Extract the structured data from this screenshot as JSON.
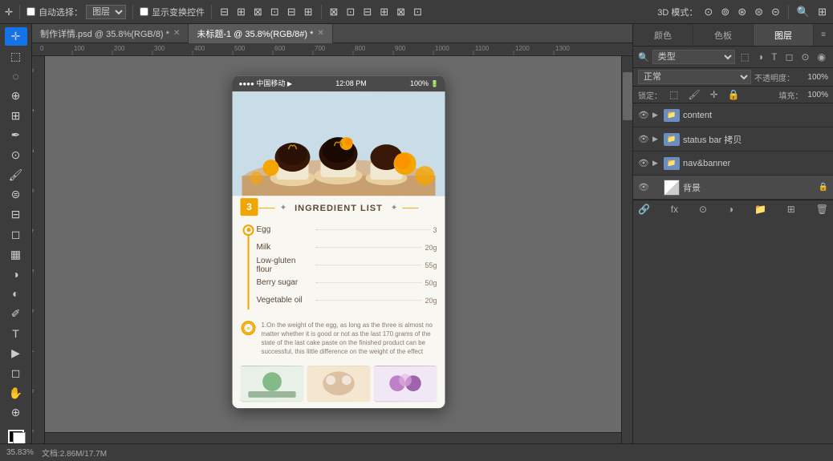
{
  "app": {
    "title": "Adobe Photoshop"
  },
  "toolbar": {
    "auto_select_label": "自动选择：",
    "layer_label": "图层",
    "show_transform_label": "显示变换控件",
    "mode_3d": "3D 模式："
  },
  "tabs": [
    {
      "label": "制作详情.psd @ 35.8%(RGB/8)",
      "active": false,
      "modified": true
    },
    {
      "label": "未标题-1 @ 35.8%(RGB/8#)",
      "active": true,
      "modified": true
    }
  ],
  "right_panel": {
    "tabs": [
      "颜色",
      "色板",
      "图层"
    ],
    "active_tab": "图层",
    "search_placeholder": "类型",
    "blend_mode": "正常",
    "opacity_label": "不透明度：",
    "opacity_value": "100%",
    "fill_label": "填充：",
    "fill_value": "100%",
    "lock_label": "锁定："
  },
  "layers": [
    {
      "name": "content",
      "type": "folder",
      "visible": true,
      "locked": false
    },
    {
      "name": "status bar 拷贝",
      "type": "folder",
      "visible": true,
      "locked": false
    },
    {
      "name": "nav&banner",
      "type": "folder",
      "visible": true,
      "locked": false
    },
    {
      "name": "背景",
      "type": "image",
      "visible": true,
      "locked": true
    }
  ],
  "phone": {
    "status_bar": {
      "carrier": "中国移动",
      "time": "12:08 PM",
      "battery": "100%"
    },
    "section": {
      "number": "3",
      "title": "INGREDIENT LIST"
    },
    "ingredients": [
      {
        "name": "Egg",
        "qty": "3"
      },
      {
        "name": "Milk",
        "qty": "20g"
      },
      {
        "name": "Low-gluten flour",
        "qty": "55g"
      },
      {
        "name": "Berry sugar",
        "qty": "50g"
      },
      {
        "name": "Vegetable oil",
        "qty": "20g"
      }
    ],
    "notes": "1.On the weight of the egg, as long as the three is almost no matter whether it is good or not as the last 170 grams of the state of the last cake paste on the finished product can be successful, this little difference on the weight of the effect"
  },
  "status_bar": {
    "zoom": "35.83%",
    "doc_size": "文档:2.86M/17.7M"
  },
  "icons": {
    "move_tool": "✛",
    "select": "⬚",
    "lasso": "◌",
    "crop": "⊕",
    "eyedropper": "✒",
    "healing": "⊙",
    "brush": "🖌",
    "clone": "⊜",
    "eraser": "◻",
    "gradient": "▦",
    "dodge": "◑",
    "pen": "✐",
    "type": "T",
    "shape": "◻",
    "hand": "✋",
    "zoom_tool": "⊕",
    "eye": "👁",
    "lock": "🔒"
  }
}
